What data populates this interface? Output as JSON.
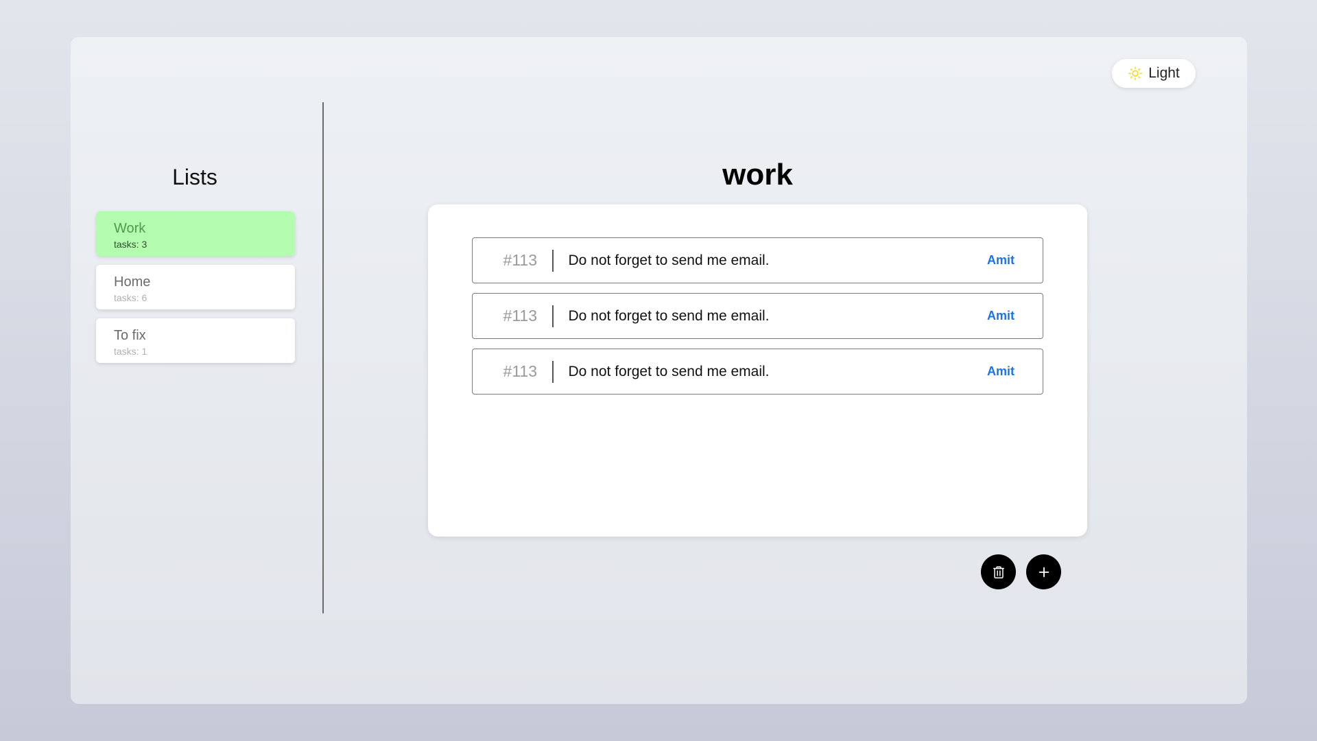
{
  "theme_toggle": {
    "label": "Light",
    "icon": "sun-icon",
    "icon_color": "#f5d800"
  },
  "sidebar": {
    "title": "Lists",
    "items": [
      {
        "name": "Work",
        "count": "tasks: 3",
        "active": true
      },
      {
        "name": "Home",
        "count": "tasks: 6",
        "active": false
      },
      {
        "name": "To fix",
        "count": "tasks: 1",
        "active": false
      }
    ]
  },
  "main": {
    "title": "work",
    "tasks": [
      {
        "id": "#113",
        "text": "Do not forget to send me email.",
        "assignee": "Amit"
      },
      {
        "id": "#113",
        "text": "Do not forget to send me email.",
        "assignee": "Amit"
      },
      {
        "id": "#113",
        "text": "Do not forget to send me email.",
        "assignee": "Amit"
      }
    ]
  },
  "actions": {
    "delete_icon": "trash-icon",
    "add_icon": "plus-icon"
  },
  "colors": {
    "active_list": "#b4fdb0",
    "assignee": "#1a73e8",
    "fab": "#000000"
  }
}
